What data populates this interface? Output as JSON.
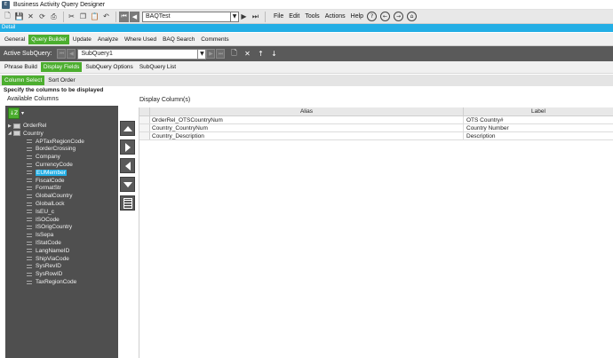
{
  "window": {
    "title": "Business Activity Query Designer",
    "app_icon": "epicor-icon"
  },
  "toolbar": {
    "baq_value": "BAQTest",
    "menus": [
      "File",
      "Edit",
      "Tools",
      "Actions",
      "Help"
    ]
  },
  "detail_bar": {
    "label": "Detail"
  },
  "main_tabs": [
    {
      "label": "General",
      "active": false
    },
    {
      "label": "Query Builder",
      "active": true
    },
    {
      "label": "Update",
      "active": false
    },
    {
      "label": "Analyze",
      "active": false
    },
    {
      "label": "Where Used",
      "active": false
    },
    {
      "label": "BAQ Search",
      "active": false
    },
    {
      "label": "Comments",
      "active": false
    }
  ],
  "subquery_bar": {
    "label": "Active SubQuery:",
    "value": "SubQuery1"
  },
  "sub_tabs": [
    {
      "label": "Phrase Build",
      "active": false
    },
    {
      "label": "Display Fields",
      "active": true
    },
    {
      "label": "SubQuery Options",
      "active": false
    },
    {
      "label": "SubQuery List",
      "active": false
    }
  ],
  "inner_tabs": [
    {
      "label": "Column Select",
      "active": true
    },
    {
      "label": "Sort Order",
      "active": false
    }
  ],
  "instruction": "Specify the columns to be displayed",
  "available_columns": {
    "header": "Available Columns",
    "tables": [
      {
        "name": "OrderRel",
        "expanded": false
      },
      {
        "name": "Country",
        "expanded": true
      }
    ],
    "fields": [
      "APTaxRegionCode",
      "BorderCrossing",
      "Company",
      "CurrencyCode",
      "EUMember",
      "FiscalCode",
      "FormatStr",
      "GlobalCountry",
      "GlobalLock",
      "IsEU_c",
      "ISOCode",
      "ISOrigCountry",
      "IsSepa",
      "IStatCode",
      "LangNameID",
      "ShipViaCode",
      "SysRevID",
      "SysRowID",
      "TaxRegionCode"
    ],
    "selected_field": "EUMember"
  },
  "display_columns": {
    "header": "Display Column(s)",
    "columns": {
      "alias": "Alias",
      "label": "Label"
    },
    "rows": [
      {
        "alias": "OrderRel_OTSCountryNum",
        "label": "OTS Country#"
      },
      {
        "alias": "Country_CountryNum",
        "label": "Country Number"
      },
      {
        "alias": "Country_Description",
        "label": "Description"
      }
    ]
  },
  "colors": {
    "accent_green": "#4cae2f",
    "detail_blue": "#23aee5",
    "panel_dark": "#4f4f4f"
  }
}
